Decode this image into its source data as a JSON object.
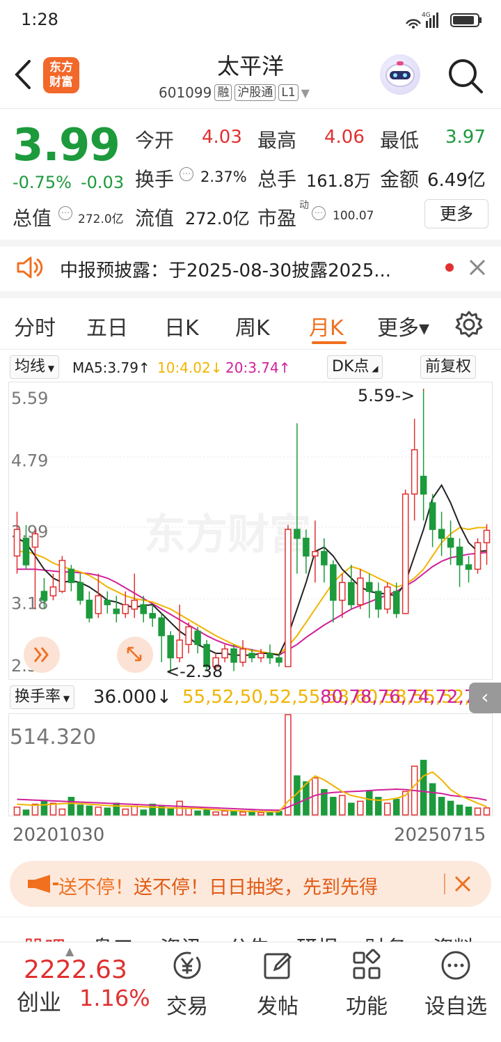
{
  "status": {
    "time": "1:28",
    "net": "4G"
  },
  "header": {
    "title": "太平洋",
    "code": "601099",
    "tags": [
      "融",
      "沪股通",
      "L1"
    ],
    "logo_text": "东方财富"
  },
  "quote": {
    "price": "3.99",
    "change_pct": "-0.75%",
    "change_abs": "-0.03",
    "open_label": "今开",
    "open": "4.03",
    "high_label": "最高",
    "high": "4.06",
    "low_label": "最低",
    "low": "3.97",
    "turnover_label": "换手",
    "turnover": "2.37%",
    "volume_label": "总手",
    "volume": "161.8万",
    "amount_label": "金额",
    "amount": "6.49亿",
    "mktcap_label": "总值",
    "mktcap": "272.0亿",
    "float_label": "流值",
    "float": "272.0亿",
    "pe_label": "市盈",
    "pe_sup": "动",
    "pe": "100.07",
    "more": "更多"
  },
  "notice": {
    "text": "中报预披露：于2025-08-30披露2025..."
  },
  "tabs": [
    {
      "label": "分时"
    },
    {
      "label": "五日"
    },
    {
      "label": "日K"
    },
    {
      "label": "周K"
    },
    {
      "label": "月K"
    },
    {
      "label": "更多▾"
    }
  ],
  "ma": {
    "type": "均线",
    "ma5": "MA5:3.79↑",
    "ma10": "10:4.02↓",
    "ma20": "20:3.74↑",
    "dk": "DK点",
    "adjust": "前复权"
  },
  "colors": {
    "up": "#e03030",
    "down": "#1c9a3c",
    "ma5": "#222222",
    "ma10": "#f0b400",
    "ma20": "#d0209a",
    "accent": "#f07020"
  },
  "chart_data": {
    "type": "candlestick",
    "y_ticks": [
      "5.59",
      "4.79",
      "3.99",
      "3.18",
      "2.38"
    ],
    "ylim": [
      2.38,
      5.59
    ],
    "max_marker": "5.59->",
    "min_marker": "<-2.38",
    "watermark": "东方财富",
    "candles": [
      [
        3.7,
        4.0,
        3.5,
        4.2
      ],
      [
        3.9,
        3.6,
        3.55,
        4.05
      ],
      [
        3.8,
        3.95,
        3.1,
        4.0
      ],
      [
        3.3,
        3.2,
        3.1,
        3.45
      ],
      [
        3.25,
        3.35,
        3.2,
        3.5
      ],
      [
        3.3,
        3.65,
        3.28,
        3.7
      ],
      [
        3.55,
        3.4,
        3.3,
        3.6
      ],
      [
        3.4,
        3.2,
        3.15,
        3.5
      ],
      [
        3.2,
        3.0,
        2.95,
        3.3
      ],
      [
        3.05,
        3.25,
        3.0,
        3.5
      ],
      [
        3.2,
        3.15,
        3.05,
        3.3
      ],
      [
        3.1,
        3.05,
        2.95,
        3.25
      ],
      [
        3.05,
        3.15,
        3.0,
        3.3
      ],
      [
        3.1,
        3.2,
        3.0,
        3.5
      ],
      [
        3.15,
        3.05,
        2.95,
        3.25
      ],
      [
        3.05,
        3.0,
        2.9,
        3.15
      ],
      [
        3.0,
        2.8,
        2.5,
        3.05
      ],
      [
        2.8,
        2.55,
        2.38,
        2.85
      ],
      [
        2.55,
        2.75,
        2.5,
        3.15
      ],
      [
        2.7,
        2.9,
        2.6,
        2.95
      ],
      [
        2.85,
        2.7,
        2.6,
        2.9
      ],
      [
        2.7,
        2.45,
        2.4,
        2.75
      ],
      [
        2.45,
        2.55,
        2.4,
        2.6
      ],
      [
        2.55,
        2.65,
        2.5,
        2.7
      ],
      [
        2.65,
        2.5,
        2.4,
        2.7
      ],
      [
        2.5,
        2.65,
        2.45,
        2.75
      ],
      [
        2.6,
        2.55,
        2.5,
        2.65
      ],
      [
        2.55,
        2.6,
        2.5,
        2.65
      ],
      [
        2.6,
        2.55,
        2.48,
        2.7
      ],
      [
        2.55,
        2.5,
        2.45,
        2.6
      ],
      [
        2.45,
        4.0,
        2.45,
        4.05
      ],
      [
        4.0,
        3.9,
        3.5,
        5.2
      ],
      [
        3.9,
        3.7,
        3.5,
        4.0
      ],
      [
        3.7,
        3.75,
        3.4,
        4.1
      ],
      [
        3.75,
        3.6,
        3.4,
        3.9
      ],
      [
        3.6,
        3.2,
        2.95,
        3.65
      ],
      [
        3.2,
        3.4,
        3.0,
        3.5
      ],
      [
        3.4,
        3.15,
        3.1,
        3.6
      ],
      [
        3.15,
        3.45,
        3.1,
        3.55
      ],
      [
        3.4,
        3.3,
        3.0,
        3.5
      ],
      [
        3.3,
        3.1,
        3.0,
        3.4
      ],
      [
        3.1,
        3.35,
        3.05,
        3.4
      ],
      [
        3.3,
        3.05,
        3.0,
        3.4
      ],
      [
        3.05,
        4.4,
        3.05,
        4.45
      ],
      [
        4.4,
        4.9,
        4.1,
        5.25
      ],
      [
        4.6,
        4.4,
        4.1,
        5.59
      ],
      [
        4.3,
        4.0,
        3.8,
        4.4
      ],
      [
        4.0,
        3.9,
        3.7,
        4.2
      ],
      [
        3.9,
        3.8,
        3.6,
        4.1
      ],
      [
        3.8,
        3.6,
        3.35,
        3.9
      ],
      [
        3.6,
        3.55,
        3.4,
        3.7
      ],
      [
        3.55,
        3.85,
        3.5,
        3.9
      ],
      [
        3.85,
        3.99,
        3.6,
        4.06
      ]
    ],
    "ma5": [
      3.9,
      3.85,
      3.7,
      3.55,
      3.45,
      3.4,
      3.42,
      3.4,
      3.35,
      3.28,
      3.2,
      3.18,
      3.14,
      3.12,
      3.14,
      3.15,
      3.05,
      2.95,
      2.85,
      2.78,
      2.7,
      2.65,
      2.6,
      2.6,
      2.58,
      2.58,
      2.58,
      2.6,
      2.6,
      2.58,
      2.8,
      3.1,
      3.4,
      3.75,
      3.8,
      3.7,
      3.55,
      3.45,
      3.35,
      3.3,
      3.28,
      3.27,
      3.25,
      3.4,
      3.7,
      4.0,
      4.35,
      4.5,
      4.3,
      4.05,
      3.85,
      3.75,
      3.76
    ],
    "ma10": [
      3.75,
      3.75,
      3.72,
      3.68,
      3.62,
      3.58,
      3.55,
      3.52,
      3.48,
      3.42,
      3.35,
      3.3,
      3.25,
      3.22,
      3.2,
      3.18,
      3.14,
      3.1,
      3.04,
      2.98,
      2.92,
      2.86,
      2.8,
      2.75,
      2.7,
      2.66,
      2.63,
      2.62,
      2.6,
      2.59,
      2.68,
      2.8,
      2.95,
      3.1,
      3.25,
      3.4,
      3.5,
      3.58,
      3.55,
      3.5,
      3.45,
      3.4,
      3.35,
      3.38,
      3.45,
      3.55,
      3.7,
      3.85,
      3.95,
      4.02,
      4.0,
      4.02,
      4.02
    ],
    "ma20": [
      3.55,
      3.55,
      3.55,
      3.54,
      3.53,
      3.52,
      3.52,
      3.51,
      3.5,
      3.48,
      3.45,
      3.4,
      3.34,
      3.28,
      3.22,
      3.16,
      3.1,
      3.04,
      2.98,
      2.92,
      2.86,
      2.8,
      2.75,
      2.71,
      2.68,
      2.66,
      2.64,
      2.62,
      2.6,
      2.58,
      2.64,
      2.7,
      2.78,
      2.85,
      2.92,
      2.98,
      3.04,
      3.1,
      3.14,
      3.18,
      3.22,
      3.26,
      3.3,
      3.36,
      3.42,
      3.5,
      3.58,
      3.64,
      3.68,
      3.7,
      3.72,
      3.73,
      3.74
    ]
  },
  "turnover_chart": {
    "type": "bar",
    "label": "换手率",
    "current": "36.000↓",
    "ma1": [
      55,
      52,
      50,
      52,
      55,
      58,
      60,
      58,
      55,
      52,
      48,
      46,
      45,
      44,
      42,
      40,
      38,
      36,
      35,
      34,
      33,
      30,
      27,
      24,
      22,
      20,
      18,
      17,
      16,
      16,
      70,
      110,
      160,
      200,
      180,
      150,
      120,
      100,
      90,
      80,
      75,
      78,
      85,
      100,
      150,
      200,
      220,
      180,
      130,
      100,
      80,
      60,
      42
    ],
    "ma2": [
      80,
      78,
      76,
      74,
      72,
      70,
      68,
      66,
      64,
      62,
      60,
      58,
      56,
      54,
      52,
      50,
      48,
      46,
      44,
      42,
      40,
      38,
      36,
      34,
      32,
      30,
      28,
      26,
      25,
      24,
      40,
      60,
      80,
      100,
      110,
      115,
      118,
      120,
      122,
      125,
      128,
      130,
      132,
      130,
      125,
      120,
      115,
      110,
      100,
      95,
      90,
      85,
      75.54
    ],
    "ymax_label": "514.320",
    "ymax": 514.32,
    "values": [
      40,
      25,
      55,
      70,
      60,
      30,
      90,
      50,
      45,
      40,
      35,
      60,
      30,
      45,
      25,
      55,
      45,
      30,
      70,
      35,
      20,
      25,
      15,
      20,
      18,
      15,
      20,
      12,
      15,
      18,
      514,
      200,
      170,
      190,
      130,
      90,
      100,
      60,
      70,
      120,
      90,
      60,
      80,
      120,
      250,
      280,
      160,
      90,
      70,
      50,
      40,
      35,
      36
    ],
    "x_start": "20201030",
    "x_end": "20250715"
  },
  "promo": {
    "text": "送不停！日日抽奖，先到先得"
  },
  "subtabs": [
    "股吧",
    "盘口",
    "资讯",
    "公告",
    "研报",
    "财务",
    "资料"
  ],
  "index_quote": {
    "value": "2222.63",
    "name": "创业",
    "pct": "1.16%"
  },
  "bottom_nav": [
    {
      "label": "交易",
      "icon": "yuan-icon"
    },
    {
      "label": "发帖",
      "icon": "edit-icon"
    },
    {
      "label": "功能",
      "icon": "grid-icon"
    },
    {
      "label": "设自选",
      "icon": "more-icon"
    }
  ]
}
